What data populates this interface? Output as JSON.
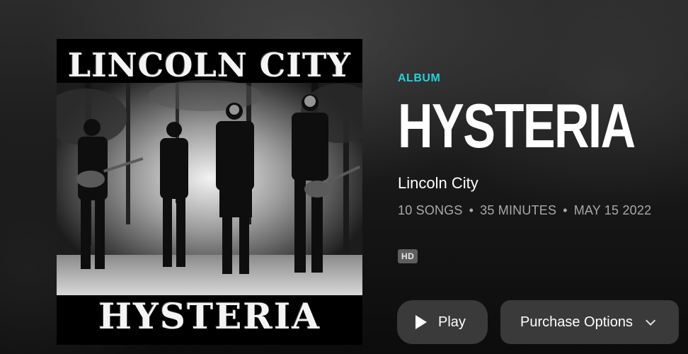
{
  "album": {
    "type_label": "ALBUM",
    "title": "HYSTERIA",
    "artist": "Lincoln City",
    "song_count": "10 SONGS",
    "duration": "35 MINUTES",
    "release_date": "MAY 15 2022",
    "quality_badge": "HD"
  },
  "cover": {
    "band_name": "LINCOLN CITY",
    "album_name": "HYSTERIA"
  },
  "actions": {
    "play_label": "Play",
    "purchase_label": "Purchase Options"
  },
  "icons": {
    "play": "play-icon",
    "chevron": "chevron-down-icon"
  },
  "colors": {
    "accent": "#25d1da",
    "button_bg": "#3a3a3a",
    "badge_bg": "#5e5e5e"
  }
}
